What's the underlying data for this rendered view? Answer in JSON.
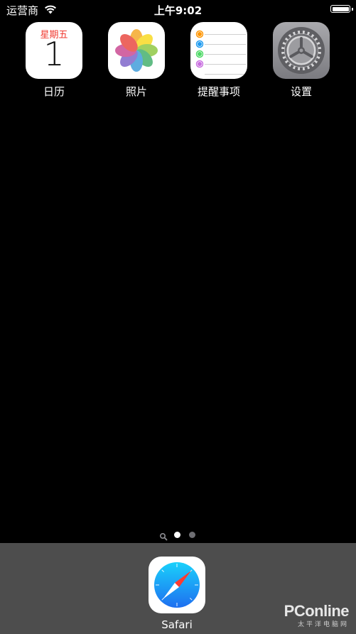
{
  "status_bar": {
    "carrier": "运营商",
    "time": "上午9:02",
    "battery_level": 1.0
  },
  "home_apps": [
    {
      "name": "日历",
      "icon": "calendar-icon",
      "weekday": "星期五",
      "day": "1"
    },
    {
      "name": "照片",
      "icon": "photos-icon"
    },
    {
      "name": "提醒事项",
      "icon": "reminders-icon"
    },
    {
      "name": "设置",
      "icon": "settings-gear-icon"
    }
  ],
  "page_indicator": {
    "pages": 2,
    "current_page": 1,
    "has_search_page": true
  },
  "dock": {
    "apps": [
      {
        "name": "Safari",
        "icon": "safari-compass-icon"
      }
    ]
  },
  "watermark": {
    "logo": "PConline",
    "sub": "太平洋电脑网"
  },
  "colors": {
    "background": "#000000",
    "dock": "#4d4d4d",
    "calendar_red": "#f0392f",
    "settings_gray": "#8e8e93"
  }
}
